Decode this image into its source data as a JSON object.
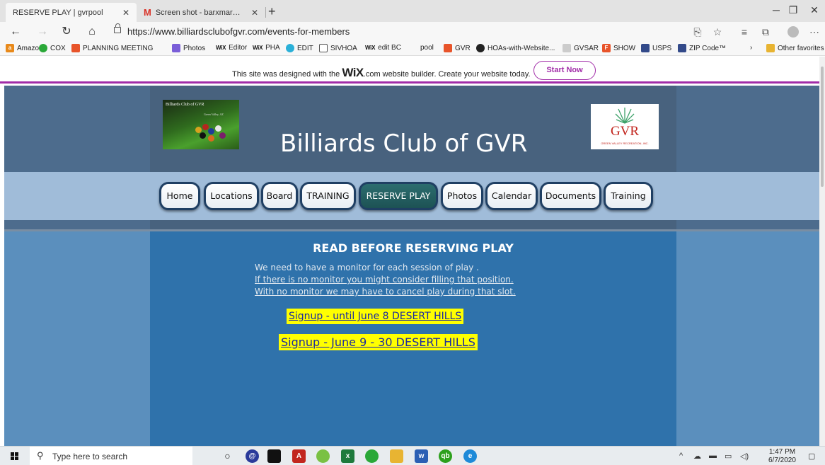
{
  "browser": {
    "tabs": [
      {
        "title": "RESERVE PLAY | gvrpool",
        "active": true
      },
      {
        "title": "Screen shot - barxmar@gmail.co",
        "active": false
      }
    ],
    "url": "https://www.billiardsclubofgvr.com/events-for-members",
    "favorites": [
      {
        "label": "Amazon",
        "icon": "amazon-icon",
        "color": "#e8891a"
      },
      {
        "label": "COX",
        "icon": "cox-icon",
        "color": "#2aa838"
      },
      {
        "label": "PLANNING MEETING",
        "icon": "meeting-icon",
        "color": "#e8542a"
      },
      {
        "label": "Photos",
        "icon": "photos-icon",
        "color": "#7a5ed8"
      },
      {
        "label": "Editor",
        "icon": "wix-icon",
        "color": "#111111"
      },
      {
        "label": "PHA",
        "icon": "wix-icon",
        "color": "#111111"
      },
      {
        "label": "EDIT",
        "icon": "edit-icon",
        "color": "#2ab0d8"
      },
      {
        "label": "SIVHOA",
        "icon": "page-icon",
        "color": "#555555"
      },
      {
        "label": "edit BC",
        "icon": "wix-icon",
        "color": "#111111"
      },
      {
        "label": "pool",
        "icon": "",
        "color": ""
      },
      {
        "label": "GVR",
        "icon": "gvr-icon",
        "color": "#e8542a"
      },
      {
        "label": "HOAs-with-Website...",
        "icon": "hoa-icon",
        "color": "#222222"
      },
      {
        "label": "GVSAR",
        "icon": "page-icon",
        "color": "#888888"
      },
      {
        "label": "SHOW",
        "icon": "show-icon",
        "color": "#e8542a"
      },
      {
        "label": "USPS",
        "icon": "usps-icon",
        "color": "#334a8a"
      },
      {
        "label": "ZIP Code™",
        "icon": "usps-icon",
        "color": "#334a8a"
      }
    ],
    "other_favorites": "Other favorites"
  },
  "wix_banner": {
    "text_before": "This site was designed with the ",
    "brand": "WiX",
    "text_after": ".com website builder. Create your website today.",
    "button": "Start Now"
  },
  "site": {
    "title": "Billiards Club of GVR",
    "logo_left_title": "Billiards Club of GVR",
    "logo_left_sub": "Green Valley, AZ",
    "logo_right_text": "GVR",
    "logo_right_sub": "GREEN VALLEY RECREATION, INC.",
    "nav": [
      {
        "label": "Home",
        "active": false
      },
      {
        "label": "Locations",
        "active": false
      },
      {
        "label": "Board",
        "active": false
      },
      {
        "label": "TRAINING",
        "active": false
      },
      {
        "label": "RESERVE PLAY",
        "active": true
      },
      {
        "label": "Photos",
        "active": false
      },
      {
        "label": "Calendar",
        "active": false
      },
      {
        "label": "Documents",
        "active": false
      },
      {
        "label": "Training",
        "active": false
      }
    ],
    "content": {
      "heading": "READ  BEFORE RESERVING PLAY",
      "line1": "We need to have a monitor for each session of play .",
      "line2": "If there is no monitor you might consider filling that position.",
      "line3": "With no monitor we may have to cancel play during that slot.",
      "signup1": "Signup - until June 8    DESERT HILLS",
      "signup2": "Signup -  June 9 - 30  DESERT HILLS  "
    }
  },
  "taskbar": {
    "search_placeholder": "Type here to search",
    "time": "1:47 PM",
    "date": "6/7/2020"
  }
}
